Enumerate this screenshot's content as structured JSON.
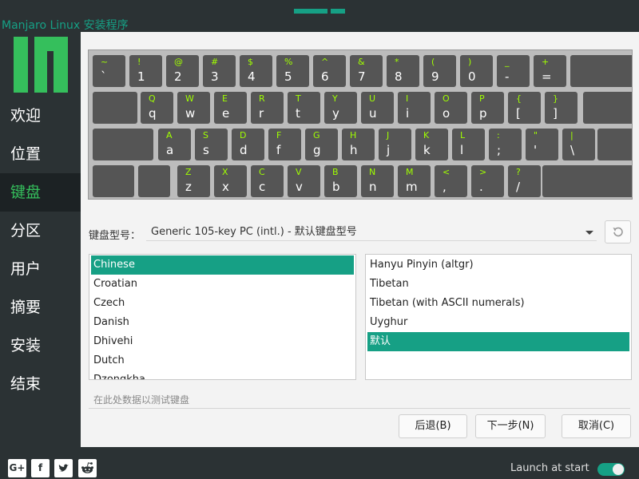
{
  "window": {
    "title": "Manjaro Linux 安装程序"
  },
  "sidebar": {
    "items": [
      {
        "label": "欢迎",
        "active": false
      },
      {
        "label": "位置",
        "active": false
      },
      {
        "label": "键盘",
        "active": true
      },
      {
        "label": "分区",
        "active": false
      },
      {
        "label": "用户",
        "active": false
      },
      {
        "label": "摘要",
        "active": false
      },
      {
        "label": "安装",
        "active": false
      },
      {
        "label": "结束",
        "active": false
      }
    ]
  },
  "keyboard": {
    "rows": [
      [
        {
          "shift": "~",
          "base": "`"
        },
        {
          "shift": "!",
          "base": "1"
        },
        {
          "shift": "@",
          "base": "2"
        },
        {
          "shift": "#",
          "base": "3"
        },
        {
          "shift": "$",
          "base": "4"
        },
        {
          "shift": "%",
          "base": "5"
        },
        {
          "shift": "^",
          "base": "6"
        },
        {
          "shift": "&",
          "base": "7"
        },
        {
          "shift": "*",
          "base": "8"
        },
        {
          "shift": "(",
          "base": "9"
        },
        {
          "shift": ")",
          "base": "0"
        },
        {
          "shift": "_",
          "base": "-"
        },
        {
          "shift": "+",
          "base": "="
        }
      ],
      [
        {
          "shift": "Q",
          "base": "q"
        },
        {
          "shift": "W",
          "base": "w"
        },
        {
          "shift": "E",
          "base": "e"
        },
        {
          "shift": "R",
          "base": "r"
        },
        {
          "shift": "T",
          "base": "t"
        },
        {
          "shift": "Y",
          "base": "y"
        },
        {
          "shift": "U",
          "base": "u"
        },
        {
          "shift": "I",
          "base": "i"
        },
        {
          "shift": "O",
          "base": "o"
        },
        {
          "shift": "P",
          "base": "p"
        },
        {
          "shift": "{",
          "base": "["
        },
        {
          "shift": "}",
          "base": "]"
        }
      ],
      [
        {
          "shift": "A",
          "base": "a"
        },
        {
          "shift": "S",
          "base": "s"
        },
        {
          "shift": "D",
          "base": "d"
        },
        {
          "shift": "F",
          "base": "f"
        },
        {
          "shift": "G",
          "base": "g"
        },
        {
          "shift": "H",
          "base": "h"
        },
        {
          "shift": "J",
          "base": "j"
        },
        {
          "shift": "K",
          "base": "k"
        },
        {
          "shift": "L",
          "base": "l"
        },
        {
          "shift": ":",
          "base": ";"
        },
        {
          "shift": "\"",
          "base": "'"
        },
        {
          "shift": "|",
          "base": "\\"
        }
      ],
      [
        {
          "shift": "Z",
          "base": "z"
        },
        {
          "shift": "X",
          "base": "x"
        },
        {
          "shift": "C",
          "base": "c"
        },
        {
          "shift": "V",
          "base": "v"
        },
        {
          "shift": "B",
          "base": "b"
        },
        {
          "shift": "N",
          "base": "n"
        },
        {
          "shift": "M",
          "base": "m"
        },
        {
          "shift": "<",
          "base": ","
        },
        {
          "shift": ">",
          "base": "."
        },
        {
          "shift": "?",
          "base": "/"
        }
      ]
    ]
  },
  "model": {
    "label": "键盘型号：",
    "value": "Generic 105-key PC (intl.)  -  默认键盘型号"
  },
  "layouts": {
    "items": [
      "Chinese",
      "Croatian",
      "Czech",
      "Danish",
      "Dhivehi",
      "Dutch",
      "Dzongkha"
    ],
    "selected": "Chinese"
  },
  "variants": {
    "items": [
      "Hanyu Pinyin (altgr)",
      "Tibetan",
      "Tibetan (with ASCII numerals)",
      "Uyghur",
      "默认"
    ],
    "selected": "默认"
  },
  "test": {
    "placeholder": "在此处数据以测试键盘"
  },
  "buttons": {
    "back": "后退(B)",
    "next": "下一步(N)",
    "cancel": "取消(C)"
  },
  "footer": {
    "social": [
      "google-plus-icon",
      "facebook-icon",
      "twitter-icon",
      "reddit-icon"
    ],
    "launch_label": "Launch at start",
    "launch_enabled": true
  },
  "colors": {
    "accent": "#16a085",
    "logo": "#35bf5c",
    "key_shift": "#a0ff00"
  }
}
